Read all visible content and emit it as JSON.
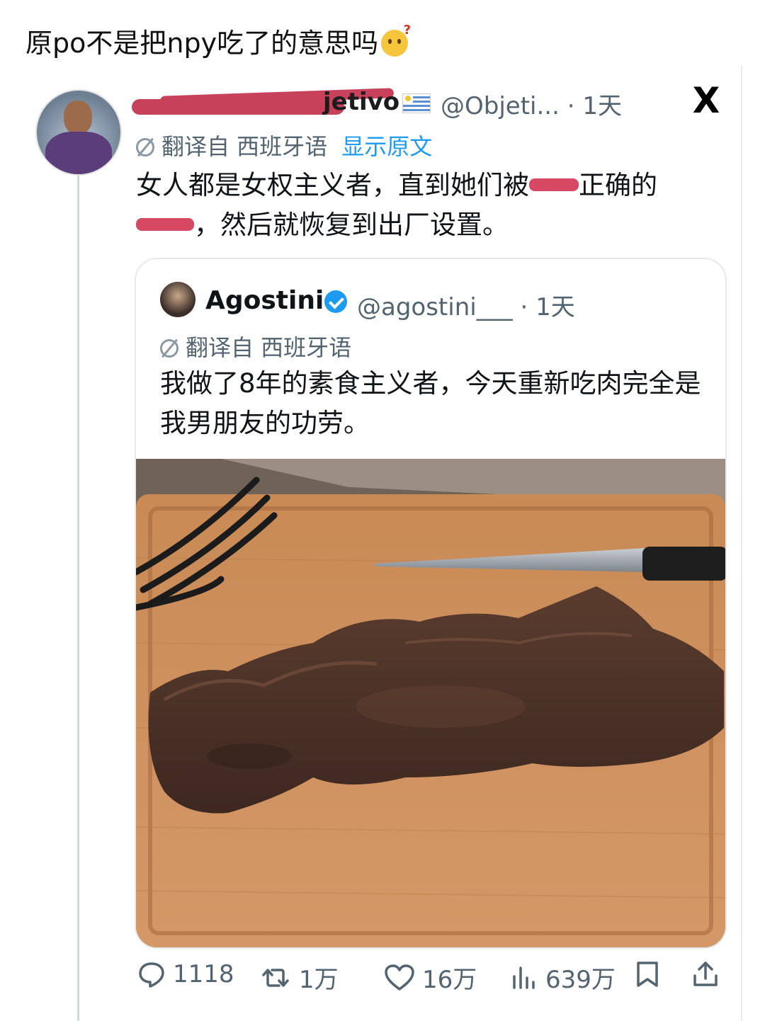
{
  "caption": {
    "text": "原po不是把npy吃了的意思吗",
    "emoji": "thinking-face-emoji"
  },
  "tweet": {
    "name_visible": "jetivo",
    "flag": "uruguay-flag",
    "handle_time": "@Objeti... · 1天",
    "translated_from": "翻译自 西班牙语",
    "show_original": "显示原文",
    "text_line1": "女人都是女权主义者，直到她们被",
    "text_line1_end": "正确的",
    "text_line2_end": "，然后就恢复到出厂设置。"
  },
  "quote": {
    "name": "Agostini",
    "handle_time": "@agostini___ · 1天",
    "translated_from": "翻译自 西班牙语",
    "text": "我做了8年的素食主义者，今天重新吃肉完全是我男朋友的功劳。",
    "image_alt": "steak on wooden cutting board with fork and knife"
  },
  "actions": {
    "replies": "1118",
    "retweets": "1万",
    "likes": "16万",
    "views": "639万"
  },
  "colors": {
    "accent": "#1d9bf0",
    "redact": "#c8415a",
    "muted": "#536471"
  }
}
